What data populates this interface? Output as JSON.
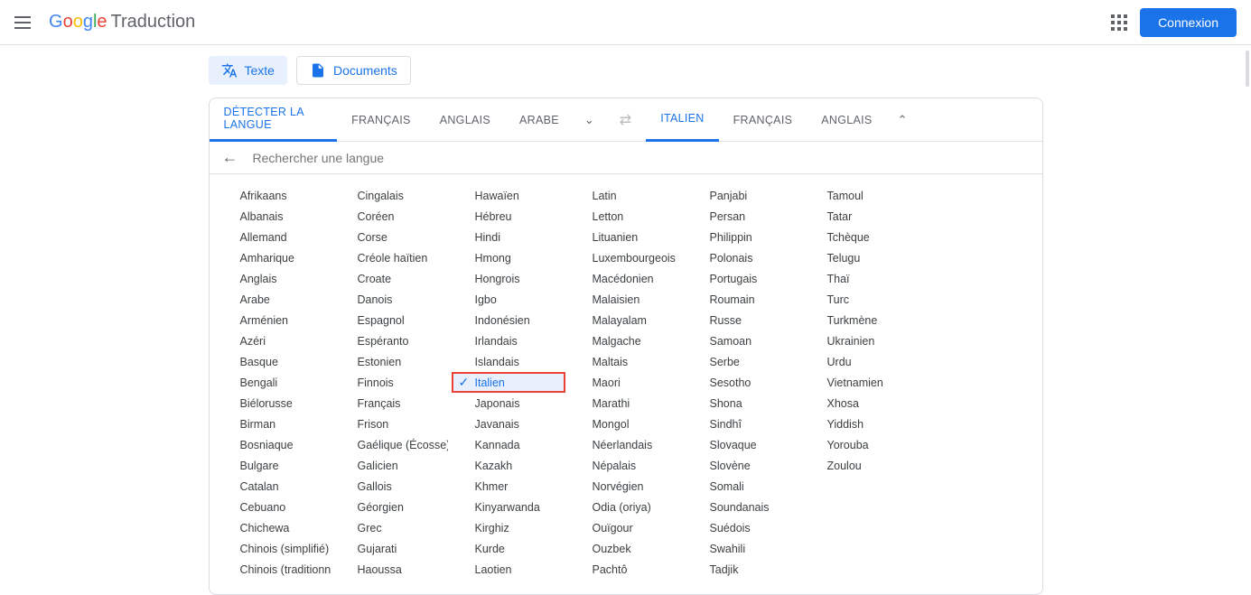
{
  "header": {
    "brand_letters": [
      "G",
      "o",
      "o",
      "g",
      "l",
      "e"
    ],
    "product": "Traduction",
    "signin": "Connexion"
  },
  "modes": {
    "text": "Texte",
    "documents": "Documents"
  },
  "source_tabs": [
    "DÉTECTER LA LANGUE",
    "FRANÇAIS",
    "ANGLAIS",
    "ARABE"
  ],
  "target_tabs": [
    "ITALIEN",
    "FRANÇAIS",
    "ANGLAIS"
  ],
  "search": {
    "placeholder": "Rechercher une langue"
  },
  "selected_language": "Italien",
  "languages_columns": [
    [
      "Afrikaans",
      "Albanais",
      "Allemand",
      "Amharique",
      "Anglais",
      "Arabe",
      "Arménien",
      "Azéri",
      "Basque",
      "Bengali",
      "Biélorusse",
      "Birman",
      "Bosniaque",
      "Bulgare",
      "Catalan",
      "Cebuano",
      "Chichewa",
      "Chinois (simplifié)",
      "Chinois (traditionnel)"
    ],
    [
      "Cingalais",
      "Coréen",
      "Corse",
      "Créole haïtien",
      "Croate",
      "Danois",
      "Espagnol",
      "Espéranto",
      "Estonien",
      "Finnois",
      "Français",
      "Frison",
      "Gaélique (Écosse)",
      "Galicien",
      "Gallois",
      "Géorgien",
      "Grec",
      "Gujarati",
      "Haoussa"
    ],
    [
      "Hawaïen",
      "Hébreu",
      "Hindi",
      "Hmong",
      "Hongrois",
      "Igbo",
      "Indonésien",
      "Irlandais",
      "Islandais",
      "Italien",
      "Japonais",
      "Javanais",
      "Kannada",
      "Kazakh",
      "Khmer",
      "Kinyarwanda",
      "Kirghiz",
      "Kurde",
      "Laotien"
    ],
    [
      "Latin",
      "Letton",
      "Lituanien",
      "Luxembourgeois",
      "Macédonien",
      "Malaisien",
      "Malayalam",
      "Malgache",
      "Maltais",
      "Maori",
      "Marathi",
      "Mongol",
      "Néerlandais",
      "Népalais",
      "Norvégien",
      "Odia (oriya)",
      "Ouïgour",
      "Ouzbek",
      "Pachtô"
    ],
    [
      "Panjabi",
      "Persan",
      "Philippin",
      "Polonais",
      "Portugais",
      "Roumain",
      "Russe",
      "Samoan",
      "Serbe",
      "Sesotho",
      "Shona",
      "Sindhî",
      "Slovaque",
      "Slovène",
      "Somali",
      "Soundanais",
      "Suédois",
      "Swahili",
      "Tadjik"
    ],
    [
      "Tamoul",
      "Tatar",
      "Tchèque",
      "Telugu",
      "Thaï",
      "Turc",
      "Turkmène",
      "Ukrainien",
      "Urdu",
      "Vietnamien",
      "Xhosa",
      "Yiddish",
      "Yorouba",
      "Zoulou"
    ]
  ]
}
